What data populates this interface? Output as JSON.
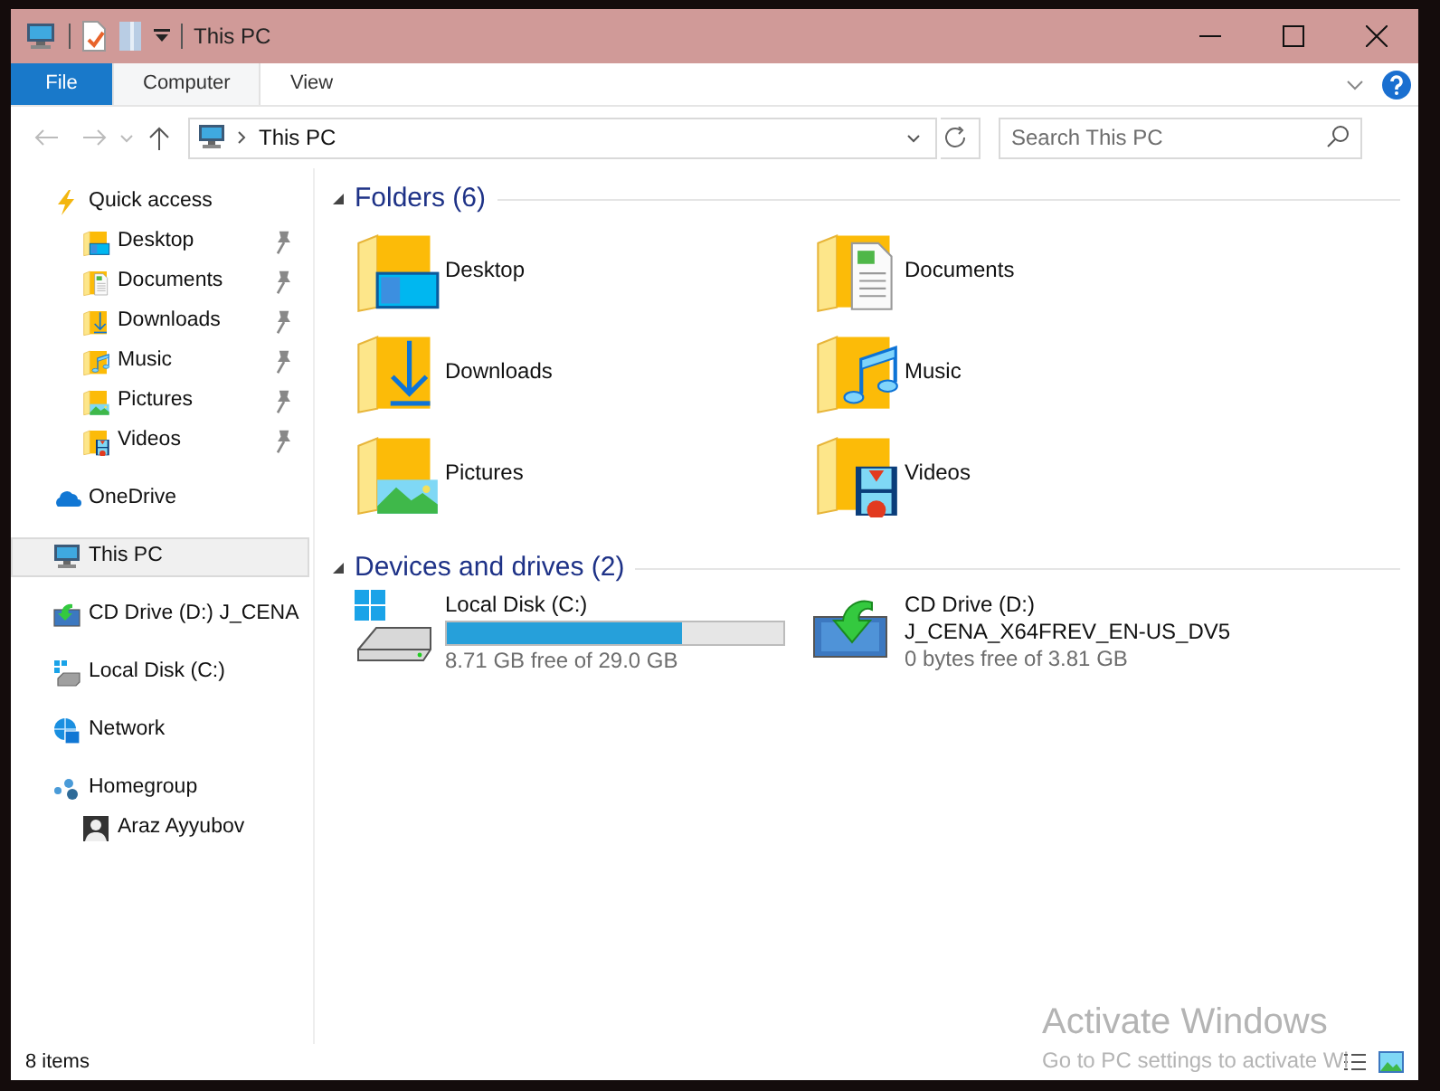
{
  "window": {
    "title": "This PC"
  },
  "ribbon": {
    "tabs": [
      {
        "label": "File",
        "kind": "file",
        "selected": false
      },
      {
        "label": "Computer",
        "kind": "tab",
        "selected": true
      },
      {
        "label": "View",
        "kind": "tab",
        "selected": false
      }
    ]
  },
  "address": {
    "path": "This PC",
    "search_placeholder": "Search This PC"
  },
  "navigation": [
    {
      "label": "Quick access",
      "kind": "quick",
      "selected": false,
      "children": [
        {
          "label": "Desktop",
          "kind": "desktop",
          "selected": false,
          "pinned": true
        },
        {
          "label": "Documents",
          "kind": "documents",
          "selected": false,
          "pinned": true
        },
        {
          "label": "Downloads",
          "kind": "downloads",
          "selected": false,
          "pinned": true
        },
        {
          "label": "Music",
          "kind": "music",
          "selected": false,
          "pinned": true
        },
        {
          "label": "Pictures",
          "kind": "pictures",
          "selected": false,
          "pinned": true
        },
        {
          "label": "Videos",
          "kind": "videos",
          "selected": false,
          "pinned": true
        }
      ]
    },
    {
      "label": "OneDrive",
      "kind": "cloud",
      "selected": false
    },
    {
      "label": "This PC",
      "kind": "pc",
      "selected": true
    },
    {
      "label": "CD Drive (D:) J_CENA",
      "kind": "cd",
      "selected": false
    },
    {
      "label": "Local Disk (C:)",
      "kind": "disk",
      "selected": false
    },
    {
      "label": "Network",
      "kind": "network",
      "selected": false
    },
    {
      "label": "Homegroup",
      "kind": "homegroup",
      "selected": false,
      "children": [
        {
          "label": "Araz Ayyubov",
          "kind": "user",
          "selected": false
        }
      ]
    }
  ],
  "sections": [
    {
      "title": "Folders (6)",
      "expanded": true,
      "kind": "folders",
      "items": [
        {
          "label": "Desktop",
          "kind": "desktop"
        },
        {
          "label": "Documents",
          "kind": "documents"
        },
        {
          "label": "Downloads",
          "kind": "downloads"
        },
        {
          "label": "Music",
          "kind": "music"
        },
        {
          "label": "Pictures",
          "kind": "pictures"
        },
        {
          "label": "Videos",
          "kind": "videos"
        }
      ]
    },
    {
      "title": "Devices and drives (2)",
      "expanded": true,
      "kind": "drives",
      "items": [
        {
          "label": "Local Disk (C:)",
          "kind": "disk",
          "level": 0.7,
          "free": "8.71 GB free of 29.0 GB"
        },
        {
          "label": "CD Drive (D:)",
          "kind": "cd",
          "volume": "J_CENA_X64FREV_EN-US_DV5",
          "free": "0 bytes free of 3.81 GB"
        }
      ]
    }
  ],
  "status_bar": {
    "count": "8 items"
  },
  "activation": {
    "title": "Activate Windows",
    "message": "Go to PC settings to activate Wi"
  }
}
